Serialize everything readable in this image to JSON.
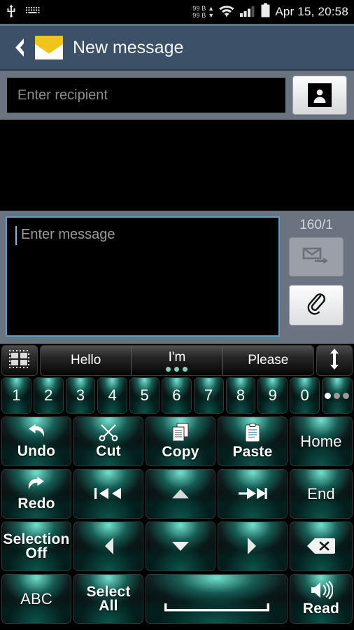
{
  "status_bar": {
    "icons": [
      "usb-icon",
      "keyboard-icon",
      "wifi-icon",
      "signal-icon",
      "battery-icon"
    ],
    "traffic_up": "99 B ▲",
    "traffic_down": "99 B ▼",
    "clock": "Apr 15, 20:58"
  },
  "action_bar": {
    "back_icon": "back-chevron-icon",
    "app_icon": "envelope-icon",
    "title": "New message",
    "bg_color": "#3c5068"
  },
  "recipient": {
    "placeholder": "Enter recipient",
    "value": "",
    "contact_picker_icon": "contact-person-icon"
  },
  "compose": {
    "placeholder": "Enter message",
    "value": "",
    "char_counter": "160/1",
    "send_icon": "send-message-icon",
    "send_enabled": false,
    "attach_icon": "paperclip-icon",
    "focus_color": "#5c9ec7"
  },
  "keyboard": {
    "suggestion_bar": {
      "left_icon": "keyboard-grid-icon",
      "right_icon": "resize-vertical-icon",
      "suggestions": [
        {
          "label": "Hello",
          "dots": 0
        },
        {
          "label": "I'm",
          "dots": 3
        },
        {
          "label": "Please",
          "dots": 0
        }
      ],
      "dot_color": "#78d6bd"
    },
    "number_row": [
      "1",
      "2",
      "3",
      "4",
      "5",
      "6",
      "7",
      "8",
      "9",
      "0"
    ],
    "ellipsis_key": "more-symbols-icon",
    "rows": [
      [
        {
          "label": "Undo",
          "icon": "undo-arrow-icon",
          "width": "undo"
        },
        {
          "label": "Cut",
          "icon": "scissors-icon",
          "width": "std"
        },
        {
          "label": "Copy",
          "icon": "copy-documents-icon",
          "width": "std"
        },
        {
          "label": "Paste",
          "icon": "clipboard-icon",
          "width": "std"
        },
        {
          "label": "Home",
          "icon": "",
          "width": "right",
          "thin": true
        }
      ],
      [
        {
          "label": "Redo",
          "icon": "redo-arrow-icon",
          "width": "undo"
        },
        {
          "label": "",
          "icon": "skip-backward-icon",
          "width": "std"
        },
        {
          "label": "",
          "icon": "arrow-up-icon",
          "width": "std"
        },
        {
          "label": "",
          "icon": "skip-forward-icon",
          "width": "std"
        },
        {
          "label": "End",
          "icon": "",
          "width": "right",
          "thin": true
        }
      ],
      [
        {
          "label": "Selection\nOff",
          "icon": "",
          "width": "undo",
          "two_line": true
        },
        {
          "label": "",
          "icon": "arrow-left-icon",
          "width": "std"
        },
        {
          "label": "",
          "icon": "arrow-down-icon",
          "width": "std"
        },
        {
          "label": "",
          "icon": "arrow-right-icon",
          "width": "std"
        },
        {
          "label": "",
          "icon": "backspace-icon",
          "width": "right"
        }
      ],
      [
        {
          "label": "ABC",
          "icon": "",
          "width": "abc",
          "thin": true
        },
        {
          "label": "Select\nAll",
          "icon": "",
          "width": "selall",
          "two_line": true
        },
        {
          "label": "",
          "icon": "spacebar-icon",
          "width": "space"
        },
        {
          "label": "Read",
          "icon": "speaker-icon",
          "width": "right"
        }
      ]
    ],
    "key_glow_color": "#78ebd7"
  }
}
